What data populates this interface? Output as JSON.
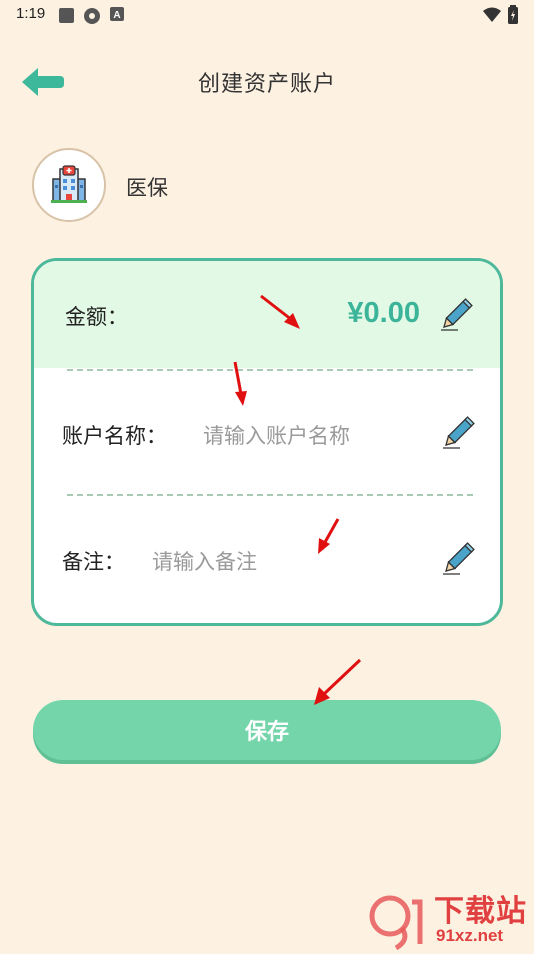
{
  "status_bar": {
    "time": "1:19"
  },
  "header": {
    "title": "创建资产账户"
  },
  "account": {
    "type_label": "医保",
    "icon": "hospital-icon"
  },
  "form": {
    "amount_label": "金额：",
    "amount_value": "¥0.00",
    "name_label": "账户名称：",
    "name_placeholder": "请输入账户名称",
    "note_label": "备注：",
    "note_placeholder": "请输入备注"
  },
  "save_button": {
    "label": "保存"
  },
  "watermark": {
    "line1": "下载站",
    "line2": "91xz.net"
  },
  "colors": {
    "accent": "#3bb49a",
    "background": "#fdf1e2",
    "button": "#74d5aa",
    "card_border": "#4db89a",
    "amount_bg": "#e2fae5"
  }
}
